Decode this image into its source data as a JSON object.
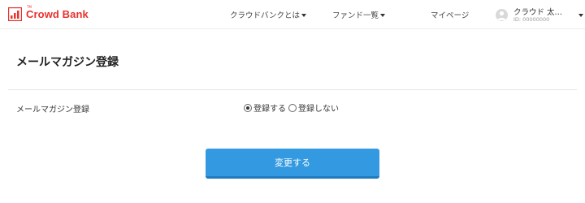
{
  "header": {
    "logo_text": "Crowd Bank",
    "logo_tm": "TM",
    "nav": [
      {
        "label": "クラウドバンクとは",
        "has_dropdown": true
      },
      {
        "label": "ファンド一覧",
        "has_dropdown": true
      },
      {
        "label": "マイページ",
        "has_dropdown": false
      }
    ],
    "user": {
      "name": "クラウド 太…",
      "id": "ID: 00000000"
    }
  },
  "main": {
    "title": "メールマガジン登録",
    "setting_label": "メールマガジン登録",
    "options": [
      {
        "label": "登録する",
        "selected": true
      },
      {
        "label": "登録しない",
        "selected": false
      }
    ],
    "submit_label": "変更する"
  },
  "colors": {
    "brand": "#e8312f",
    "primary_button": "#3399e0"
  }
}
